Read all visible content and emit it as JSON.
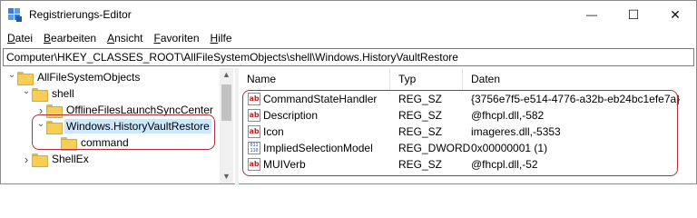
{
  "window": {
    "title": "Registrierungs-Editor",
    "controls": {
      "minimize": "—",
      "maximize": "☐",
      "close": "✕"
    }
  },
  "menu": [
    {
      "label": "Datei",
      "underline": "D",
      "rest": "atei"
    },
    {
      "label": "Bearbeiten",
      "underline": "B",
      "rest": "earbeiten"
    },
    {
      "label": "Ansicht",
      "underline": "A",
      "rest": "nsicht"
    },
    {
      "label": "Favoriten",
      "underline": "F",
      "rest": "avoriten"
    },
    {
      "label": "Hilfe",
      "underline": "H",
      "rest": "ilfe"
    }
  ],
  "address": "Computer\\HKEY_CLASSES_ROOT\\AllFileSystemObjects\\shell\\Windows.HistoryVaultRestore",
  "tree": [
    {
      "label": "AllFileSystemObjects",
      "level": 0,
      "expanded": true
    },
    {
      "label": "shell",
      "level": 1,
      "expanded": true
    },
    {
      "label": "OfflineFilesLaunchSyncCenter",
      "level": 2,
      "expanded": false
    },
    {
      "label": "Windows.HistoryVaultRestore",
      "level": 2,
      "expanded": true,
      "selected": true
    },
    {
      "label": "command",
      "level": 3,
      "expanded": null
    },
    {
      "label": "ShellEx",
      "level": 1,
      "expanded": false
    }
  ],
  "columns": {
    "name": "Name",
    "type": "Typ",
    "data": "Daten"
  },
  "values": [
    {
      "name": "CommandStateHandler",
      "type": "REG_SZ",
      "data": "{3756e7f5-e514-4776-a32b-eb24bc1efe7a}",
      "icon": "ab-icon"
    },
    {
      "name": "Description",
      "type": "REG_SZ",
      "data": "@fhcpl.dll,-582",
      "icon": "ab-icon"
    },
    {
      "name": "Icon",
      "type": "REG_SZ",
      "data": "imageres.dll,-5353",
      "icon": "ab-icon"
    },
    {
      "name": "ImpliedSelectionModel",
      "type": "REG_DWORD",
      "data": "0x00000001 (1)",
      "icon": "binary-icon"
    },
    {
      "name": "MUIVerb",
      "type": "REG_SZ",
      "data": "@fhcpl.dll,-52",
      "icon": "ab-icon"
    }
  ],
  "icons": {
    "ab": "ab",
    "binary": "011\n110"
  },
  "colors": {
    "highlight": "#b0313b",
    "selection": "#cce8ff",
    "folder": "#f5cd57"
  }
}
